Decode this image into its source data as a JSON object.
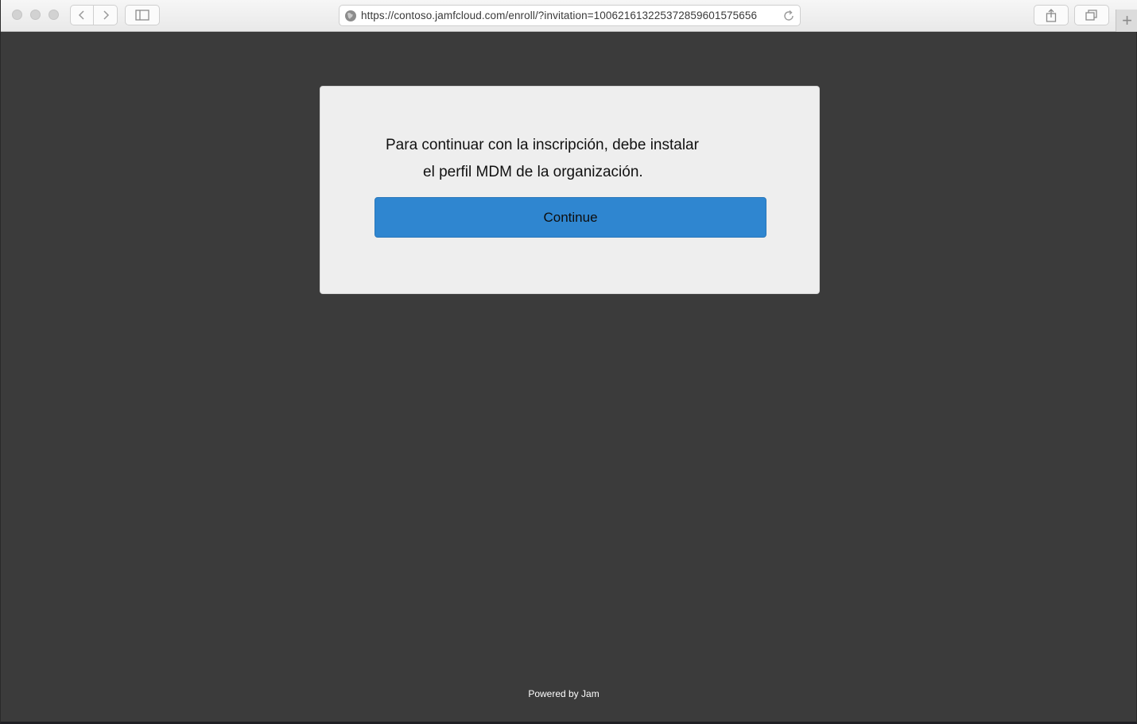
{
  "browser": {
    "url": "https://contoso.jamfcloud.com/enroll/?invitation=100621613225372859601575656",
    "new_tab_glyph": "+",
    "icons": {
      "back": "chevron-left-icon",
      "forward": "chevron-right-icon",
      "sidebar": "sidebar-icon",
      "globe": "globe-icon",
      "reload": "reload-icon",
      "share": "share-icon",
      "tabs": "tab-overview-icon"
    }
  },
  "dialog": {
    "message_line1": "Para continuar con la inscripción, debe instalar",
    "message_line2": "el perfil MDM de la organización.",
    "continue_label": "Continue"
  },
  "footer": {
    "powered_by": "Powered by Jam"
  },
  "colors": {
    "page_background": "#3b3b3b",
    "card_background": "#eeeeee",
    "button_blue": "#2f86d0"
  }
}
